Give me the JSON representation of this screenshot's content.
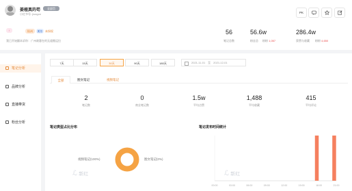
{
  "profile": {
    "name": "姜楂真的苟",
    "badge": "全部页",
    "sub_id": "小红书号: jloagon",
    "tag_gender": "♀",
    "tag_1": "杭州",
    "tag_2": "美妆",
    "tag_3": "未授权",
    "bio": "我已开始翻本诉你：广州故客在的无道搬运拉"
  },
  "header_actions": {
    "pk_label": "PK"
  },
  "stats": [
    {
      "value": "56",
      "label": "笔记总数",
      "delta": ""
    },
    {
      "value": "56.6w",
      "label": "粉丝总",
      "delta": "1,057"
    },
    {
      "value": "286.4w",
      "label": "获赞与收藏",
      "delta": "4,650"
    }
  ],
  "sidebar": {
    "items": [
      {
        "label": "笔记分析"
      },
      {
        "label": "品牌分析"
      },
      {
        "label": "直播带货"
      },
      {
        "label": "粉丝分析"
      }
    ]
  },
  "date_ranges": [
    "7天",
    "15天",
    "30天",
    "90天",
    "180天"
  ],
  "selected_range": "30天",
  "date_from": "2021-11-01",
  "date_to": "2021-12-01",
  "date_sep": "至",
  "note_tabs": [
    "全部",
    "图文笔记",
    "视频笔记"
  ],
  "summary": [
    {
      "value": "2",
      "label": "笔记数"
    },
    {
      "value": "0",
      "label": "商业笔记数"
    },
    {
      "value": "1.5w",
      "label": "平均点赞"
    },
    {
      "value": "1,488",
      "label": "平均收藏"
    },
    {
      "value": "415",
      "label": "平均评论"
    }
  ],
  "panel_left_title": "笔记类型占比分布",
  "panel_right_title": "笔记发布时间统计",
  "watermark": "新红",
  "accent": "#f5a344",
  "accent_red": "#f06a5a",
  "chart_data": [
    {
      "type": "pie",
      "categories": [
        "视频笔记",
        "图文笔记"
      ],
      "values": [
        100,
        0
      ],
      "labels": [
        "视频笔记(100%)",
        "图文笔记(0%)"
      ]
    },
    {
      "type": "bar",
      "categories": [
        "00:00",
        "03:00",
        "06:00",
        "09:00",
        "12:00",
        "15:00",
        "18:00",
        "21:00"
      ],
      "values": [
        0,
        0,
        0,
        0,
        0,
        0,
        1,
        1
      ],
      "bar_color": "#f5805f"
    }
  ]
}
